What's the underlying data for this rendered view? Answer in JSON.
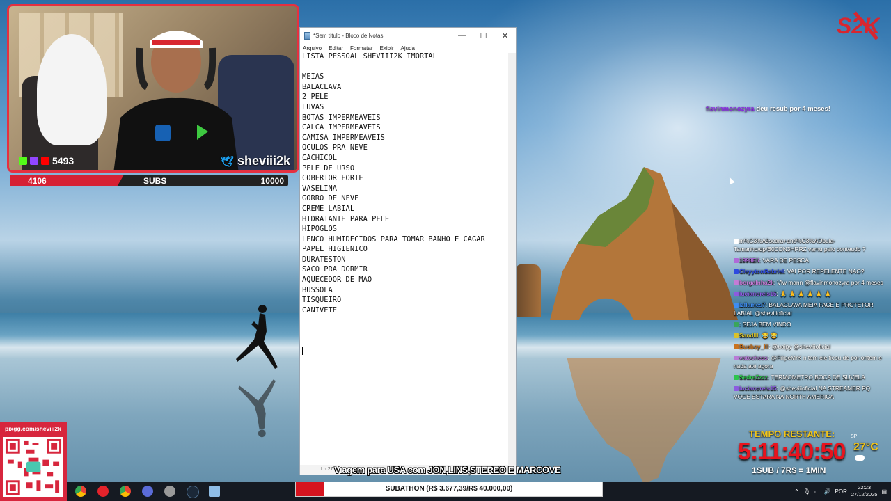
{
  "webcam": {
    "viewer_count": "5493",
    "handle": "sheviii2k"
  },
  "subs_goal": {
    "current": "4106",
    "label": "SUBS",
    "target": "10000",
    "fraction": 0.41
  },
  "notepad": {
    "title": "*Sem título - Bloco de Notas",
    "menu": [
      "Arquivo",
      "Editar",
      "Formatar",
      "Exibir",
      "Ajuda"
    ],
    "lines": [
      "LISTA PESSOAL SHEVIII2K IMORTAL",
      "",
      "MEIAS",
      "BALACLAVA",
      "2 PELE",
      "LUVAS",
      "BOTAS IMPERMEAVEIS",
      "CALCA IMPERMEAVEIS",
      "CAMISA IMPERMEAVEIS",
      "OCULOS PRA NEVE",
      "CACHICOL",
      "PELE DE URSO",
      "COBERTOR FORTE",
      "VASELINA",
      "GORRO DE NEVE",
      "CREME LABIAL",
      "HIDRATANTE PARA PELE",
      "HIPOGLOS",
      "LENCO HUMIDECIDOS PARA TOMAR BANHO E CAGAR",
      "PAPEL HIGIENICO",
      "DURATESTON",
      "SACO PRA DORMIR",
      "AQUECEDOR DE MAO",
      "BUSSOLA",
      "TISQUEIRO",
      "CANIVETE"
    ],
    "status": "Ln 27"
  },
  "resub": {
    "user": "flavinmonozyra",
    "text": " deu resub por 4 meses!"
  },
  "chat": [
    {
      "user": "",
      "text": "m%C3%A9scara+and%C3%ADbula-Tamanho/dp/B0DDN3HRRZ vamu pelo conteudo ?",
      "color": "#ffffff"
    },
    {
      "user": "1998Eli",
      "text": ": VARA DE PESCA",
      "color": "#b06ad8"
    },
    {
      "user": "CleyytonGabriel",
      "text": ": VAI POR REPELENTE NAO?",
      "color": "#2d4be0"
    },
    {
      "user": "borgalnha2k",
      "text": ": Vlw mann @flavinmonozyra por 4 meses",
      "color": "#c47cd6"
    },
    {
      "user": "lucianoreis15",
      "text": ": 🙏 🙏 🙏 🙏 🙏 🙏",
      "color": "#8c5be0"
    },
    {
      "user": "lzflames7",
      "text": ": BALACLAVA MEIA FACE E PROTETOR LABIAL @sheviiioficial",
      "color": "#3e8df0"
    },
    {
      "user": "",
      "text": ": SEJA BEM VINDO",
      "color": "#3aa65a"
    },
    {
      "user": "Sandlll",
      "text": ": 😂 😂",
      "color": "#d9c22b"
    },
    {
      "user": "Busboy_lll",
      "text": ": @uaipy @sheviiioficial",
      "color": "#c9731f"
    },
    {
      "user": "vatochess",
      "text": ": @FilipeMrK n tem ele ficou de por ontem e nada até agora",
      "color": "#b87cd6"
    },
    {
      "user": "SedreZzzz",
      "text": ": TERMOMETRO BOCA DE SUVELA",
      "color": "#2ec44e"
    },
    {
      "user": "lucianoreis15",
      "text": ": @sheviiioficial NA STREAMER PQ VOCE ESTARA NA NORTH AMERICA",
      "color": "#8c5be0"
    }
  ],
  "timer": {
    "label": "TEMPO RESTANTE:",
    "value": "5:11:40:50",
    "rate": "1SUB / 7R$ = 1MIN"
  },
  "weather": {
    "location": "SP",
    "temp": "27°C"
  },
  "qr": {
    "url": "pixgg.com/sheviii2k"
  },
  "banner": {
    "text": "Viagem para USA com JON,LINS,STEREO E MARCOVE"
  },
  "subathon": {
    "text": "SUBATHON (R$ 3.677,39/R$ 40.000,00)",
    "fraction": 0.09
  },
  "tray": {
    "lang": "POR",
    "time": "22:23",
    "date": "27/12/2025"
  },
  "colors": {
    "accent": "#e53040",
    "subathon_red": "#d6141f",
    "timer_red": "#e8141e",
    "timer_label": "#f0c419"
  }
}
